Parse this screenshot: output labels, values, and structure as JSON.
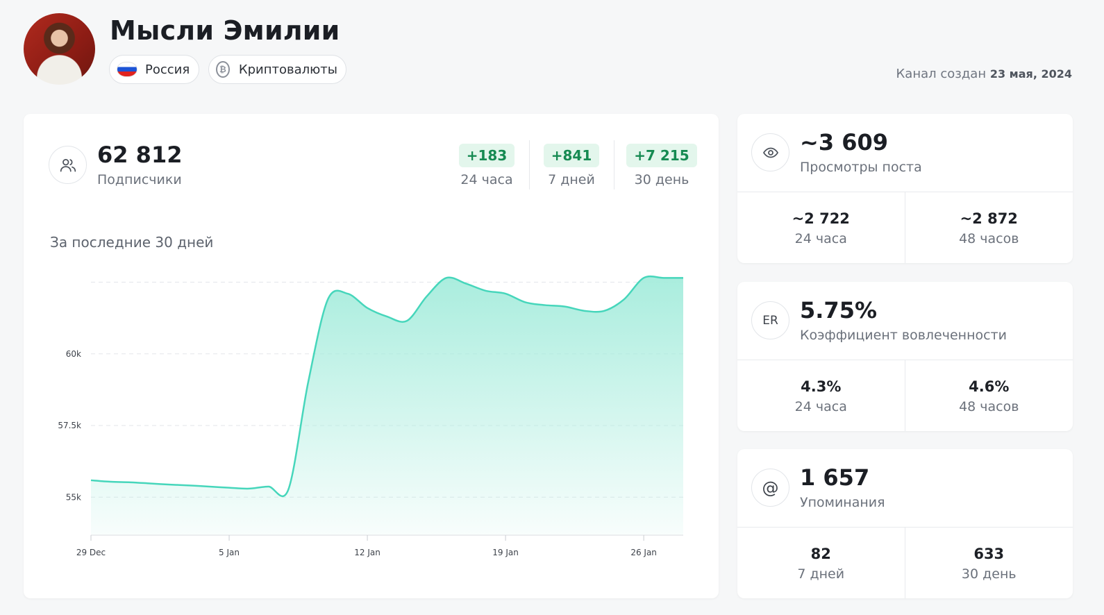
{
  "channel": {
    "title": "Мысли Эмилии",
    "country": "Россия",
    "topic": "Криптовалюты",
    "created_label": "Канал создан",
    "created_date": "23 мая, 2024"
  },
  "subscribers": {
    "value": "62 812",
    "label": "Подписчики",
    "deltas": [
      {
        "value": "+183",
        "label": "24 часа"
      },
      {
        "value": "+841",
        "label": "7 дней"
      },
      {
        "value": "+7 215",
        "label": "30 день"
      }
    ],
    "period_title": "За последние 30 дней"
  },
  "views": {
    "value": "~3 609",
    "label": "Просмотры поста",
    "cells": [
      {
        "value": "~2 722",
        "label": "24 часа"
      },
      {
        "value": "~2 872",
        "label": "48 часов"
      }
    ]
  },
  "er": {
    "icon_text": "ER",
    "value": "5.75%",
    "label": "Коэффициент вовлеченности",
    "cells": [
      {
        "value": "4.3%",
        "label": "24 часа"
      },
      {
        "value": "4.6%",
        "label": "48 часов"
      }
    ]
  },
  "mentions": {
    "value": "1 657",
    "label": "Упоминания",
    "cells": [
      {
        "value": "82",
        "label": "7 дней"
      },
      {
        "value": "633",
        "label": "30 день"
      }
    ]
  },
  "colors": {
    "accent_line": "#46d6bb",
    "accent_fill": "#a5ecdc",
    "delta_bg": "#e3f6ec",
    "delta_text": "#168a52"
  },
  "chart_data": {
    "type": "area",
    "title": "",
    "xlabel": "",
    "ylabel": "",
    "x_ticks": [
      "29 Dec",
      "5 Jan",
      "12 Jan",
      "19 Jan",
      "26 Jan"
    ],
    "y_ticks": [
      "55k",
      "57.5k",
      "60k"
    ],
    "y_tick_values": [
      55000,
      57500,
      60000
    ],
    "ylim": [
      53700,
      62900
    ],
    "grid": true,
    "x": [
      "2024-12-29",
      "2024-12-30",
      "2024-12-31",
      "2025-01-01",
      "2025-01-02",
      "2025-01-03",
      "2025-01-04",
      "2025-01-05",
      "2025-01-06",
      "2025-01-07",
      "2025-01-08",
      "2025-01-09",
      "2025-01-10",
      "2025-01-11",
      "2025-01-12",
      "2025-01-13",
      "2025-01-14",
      "2025-01-15",
      "2025-01-16",
      "2025-01-17",
      "2025-01-18",
      "2025-01-19",
      "2025-01-20",
      "2025-01-21",
      "2025-01-22",
      "2025-01-23",
      "2025-01-24",
      "2025-01-25",
      "2025-01-26",
      "2025-01-27",
      "2025-01-28"
    ],
    "series": [
      {
        "values": [
          55590,
          55540,
          55520,
          55480,
          55440,
          55410,
          55370,
          55330,
          55300,
          55370,
          55270,
          59000,
          61900,
          62100,
          61600,
          61300,
          61150,
          62000,
          62650,
          62450,
          62200,
          62100,
          61800,
          61700,
          61650,
          61500,
          61500,
          61900,
          62650,
          62650,
          62650
        ]
      }
    ]
  }
}
